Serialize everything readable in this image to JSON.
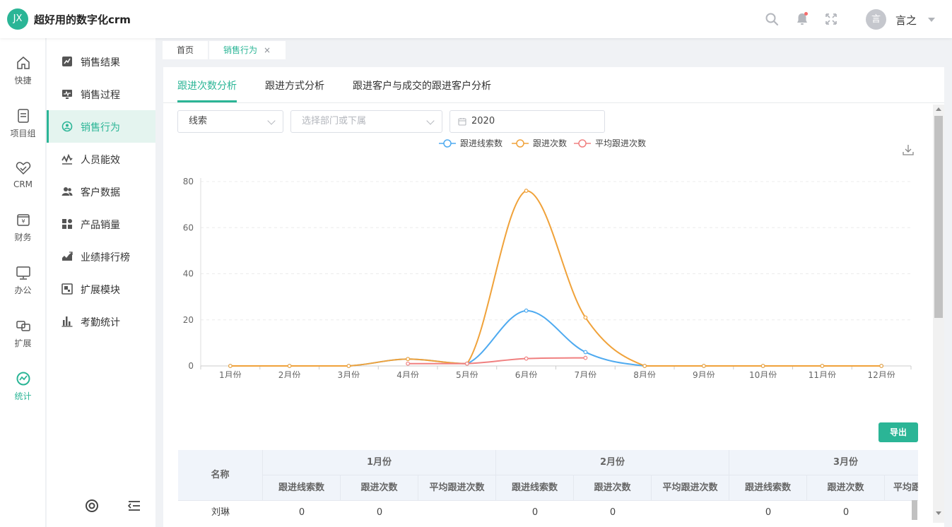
{
  "header": {
    "logo_text": "JX",
    "app_title": "超好用的数字化crm",
    "avatar_text": "言",
    "username": "言之",
    "icons": [
      "search-icon",
      "bell-icon",
      "fullscreen-icon",
      "chevron-down-icon"
    ],
    "accent_color": "#2bb596",
    "notification_dot_color": "#f56c6c"
  },
  "rail": {
    "items": [
      {
        "label": "快捷",
        "icon": "home-icon"
      },
      {
        "label": "项目组",
        "icon": "document-icon"
      },
      {
        "label": "CRM",
        "icon": "heart-handshake-icon"
      },
      {
        "label": "财务",
        "icon": "yen-wallet-icon"
      },
      {
        "label": "办公",
        "icon": "monitor-icon"
      },
      {
        "label": "扩展",
        "icon": "extend-icon"
      },
      {
        "label": "统计",
        "icon": "chart-circle-icon",
        "active": true
      }
    ],
    "bottom_icons": [
      "settings-target-icon",
      "collapse-menu-icon"
    ]
  },
  "menu": {
    "items": [
      {
        "label": "销售结果",
        "icon": "sales-result-icon"
      },
      {
        "label": "销售过程",
        "icon": "sales-process-icon"
      },
      {
        "label": "销售行为",
        "icon": "sales-behavior-icon",
        "active": true
      },
      {
        "label": "人员能效",
        "icon": "efficiency-icon"
      },
      {
        "label": "客户数据",
        "icon": "customer-icon"
      },
      {
        "label": "产品销量",
        "icon": "product-icon"
      },
      {
        "label": "业绩排行榜",
        "icon": "ranking-icon"
      },
      {
        "label": "扩展模块",
        "icon": "module-icon"
      },
      {
        "label": "考勤统计",
        "icon": "attendance-icon"
      }
    ]
  },
  "page_tabs": [
    {
      "label": "首页"
    },
    {
      "label": "销售行为",
      "active": true,
      "close": "×"
    }
  ],
  "subtabs": [
    {
      "label": "跟进次数分析",
      "active": true
    },
    {
      "label": "跟进方式分析"
    },
    {
      "label": "跟进客户与成交的跟进客户分析"
    }
  ],
  "filters": {
    "type_value": "线索",
    "dept_placeholder": "选择部门或下属",
    "year_value": "2020"
  },
  "chart_data": {
    "type": "line",
    "categories": [
      "1月份",
      "2月份",
      "3月份",
      "4月份",
      "5月份",
      "6月份",
      "7月份",
      "8月份",
      "9月份",
      "10月份",
      "11月份",
      "12月份"
    ],
    "ylim": [
      0,
      80
    ],
    "yticks": [
      0,
      20,
      40,
      60,
      80
    ],
    "legend_position": "top-center",
    "grid": "dashed horizontal",
    "series": [
      {
        "name": "跟进线索数",
        "color": "#4eaaf0",
        "values": [
          0,
          0,
          0,
          3,
          1,
          24,
          6,
          0,
          0,
          0,
          0,
          0
        ]
      },
      {
        "name": "跟进次数",
        "color": "#f0a23a",
        "values": [
          0,
          0,
          0,
          3,
          1,
          76,
          21,
          0,
          0,
          0,
          0,
          0
        ]
      },
      {
        "name": "平均跟进次数",
        "color": "#f08080",
        "values": [
          null,
          null,
          null,
          1,
          1,
          3.2,
          3.5,
          null,
          null,
          null,
          null,
          null
        ]
      }
    ]
  },
  "export_label": "导出",
  "table": {
    "name_header": "名称",
    "month_groups": [
      "1月份",
      "2月份",
      "3月份"
    ],
    "sub_headers": [
      "跟进线索数",
      "跟进次数",
      "平均跟进次数"
    ],
    "last_partial_header": "平均跟",
    "rows": [
      {
        "name": "刘琳",
        "cells": [
          "0",
          "0",
          "",
          "0",
          "0",
          "",
          "0",
          "0",
          ""
        ]
      }
    ]
  }
}
